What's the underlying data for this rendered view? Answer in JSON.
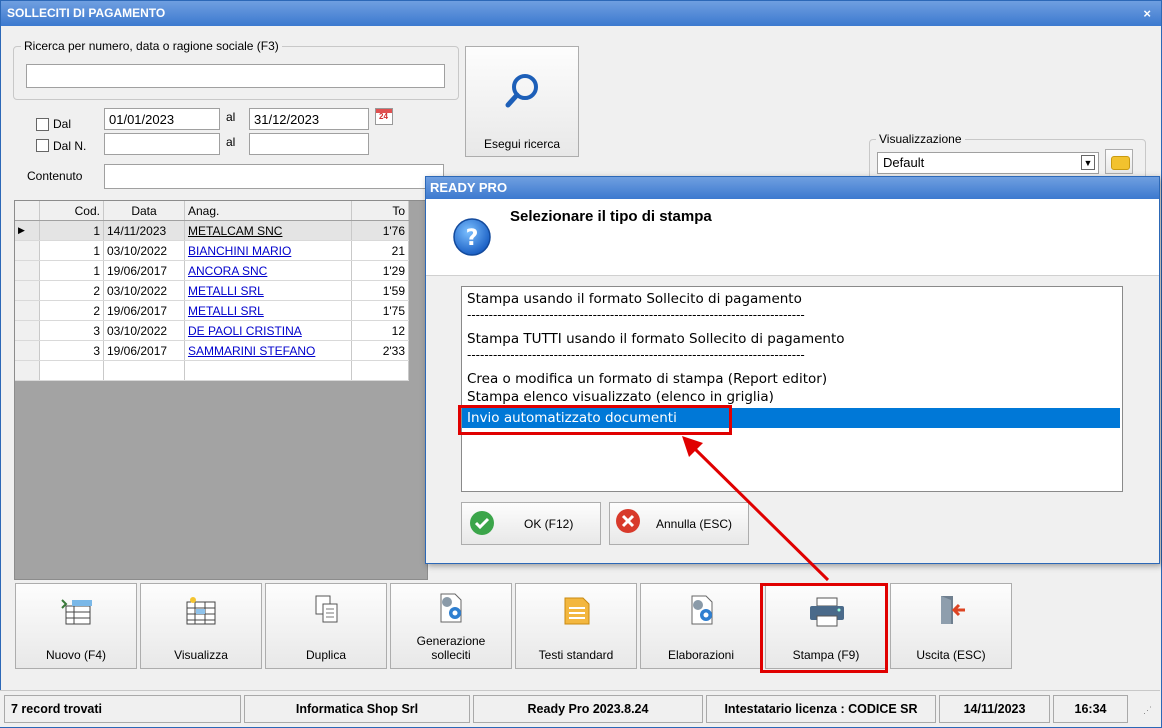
{
  "window": {
    "title": "SOLLECITI DI PAGAMENTO",
    "close": "×"
  },
  "search": {
    "legend": "Ricerca per numero, data o ragione sociale (F3)",
    "value": "",
    "dal_label": "Dal",
    "date_from": "01/01/2023",
    "al_label": "al",
    "date_to": "31/12/2023",
    "dal_n_label": "Dal N.",
    "num_from": "",
    "num_to": "",
    "contenuto_label": "Contenuto",
    "contenuto_value": "",
    "calendar_badge": "24",
    "run_button": "Esegui ricerca"
  },
  "view": {
    "legend": "Visualizzazione",
    "selected": "Default"
  },
  "grid": {
    "headers": [
      "Cod.",
      "Data",
      "Anag.",
      "To"
    ],
    "rows": [
      {
        "cod": "1",
        "data": "14/11/2023",
        "anag": "METALCAM SNC",
        "tot": "1'76"
      },
      {
        "cod": "1",
        "data": "03/10/2022",
        "anag": "BIANCHINI MARIO",
        "tot": "21"
      },
      {
        "cod": "1",
        "data": "19/06/2017",
        "anag": "ANCORA SNC",
        "tot": "1'29"
      },
      {
        "cod": "2",
        "data": "03/10/2022",
        "anag": "METALLI SRL",
        "tot": "1'59"
      },
      {
        "cod": "2",
        "data": "19/06/2017",
        "anag": "METALLI SRL",
        "tot": "1'75"
      },
      {
        "cod": "3",
        "data": "03/10/2022",
        "anag": "DE PAOLI CRISTINA",
        "tot": "12"
      },
      {
        "cod": "3",
        "data": "19/06/2017",
        "anag": "SAMMARINI STEFANO",
        "tot": "2'33"
      }
    ]
  },
  "dialog": {
    "title": "READY PRO",
    "heading": "Selezionare il tipo di stampa",
    "items": [
      "Stampa usando il formato Sollecito di pagamento",
      "------------------------------------------------------------------------------",
      "Stampa TUTTI usando il formato Sollecito di pagamento",
      "------------------------------------------------------------------------------",
      "Crea o modifica un formato di stampa (Report editor)",
      "Stampa elenco visualizzato (elenco in griglia)",
      "Invio automatizzato documenti"
    ],
    "ok": "OK (F12)",
    "cancel": "Annulla (ESC)"
  },
  "toolbar": {
    "nuovo": "Nuovo (F4)",
    "visualizza": "Visualizza",
    "duplica": "Duplica",
    "generazione_1": "Generazione",
    "generazione_2": "solleciti",
    "testi": "Testi standard",
    "elaborazioni": "Elaborazioni",
    "stampa": "Stampa (F9)",
    "uscita": "Uscita (ESC)"
  },
  "status": {
    "records": "7 record trovati",
    "company": "Informatica Shop Srl",
    "version": "Ready Pro 2023.8.24",
    "license": "Intestatario licenza : CODICE SR",
    "date": "14/11/2023",
    "time": "16:34"
  },
  "colors": {
    "accent": "#3c79cf",
    "highlight": "#0078d7",
    "annotation": "#e00000"
  }
}
